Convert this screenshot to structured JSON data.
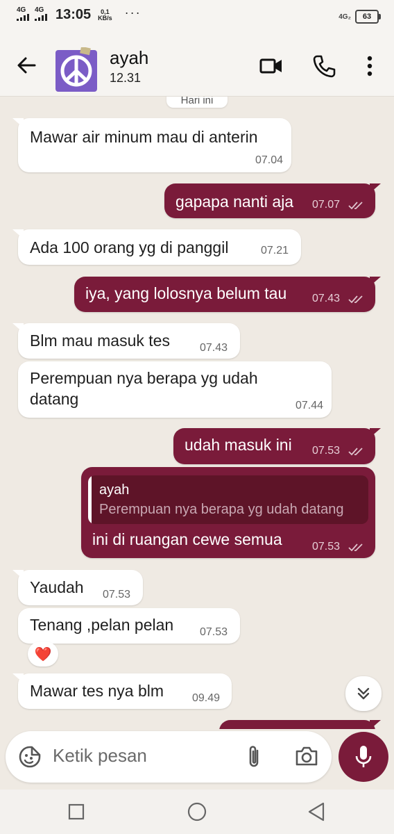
{
  "status_bar": {
    "network1": "4G",
    "network2": "4G",
    "time": "13:05",
    "speed_value": "0,1",
    "speed_unit": "KB/s",
    "dots": "···",
    "network_right": "4G₂",
    "battery": "63"
  },
  "header": {
    "name": "ayah",
    "subtitle": "12.31",
    "avatar_icon": "peace-sign-icon"
  },
  "chat": {
    "date_chip": "Hari ini",
    "messages": [
      {
        "dir": "in",
        "text": "Mawar air minum mau di anterin",
        "time": "07.04"
      },
      {
        "dir": "out",
        "text": "gapapa nanti aja",
        "time": "07.07"
      },
      {
        "dir": "in",
        "text": "Ada 100 orang yg di panggil",
        "time": "07.21"
      },
      {
        "dir": "out",
        "text": "iya, yang lolosnya belum tau",
        "time": "07.43"
      },
      {
        "dir": "in",
        "text": "Blm mau masuk tes",
        "time": "07.43"
      },
      {
        "dir": "in",
        "text": "Perempuan nya berapa yg udah\ndatang",
        "time": "07.44"
      },
      {
        "dir": "out",
        "text": "udah masuk ini",
        "time": "07.53"
      },
      {
        "dir": "out",
        "quote_name": "ayah",
        "quote_text": "Perempuan nya berapa yg udah datang",
        "text": "ini di ruangan cewe semua",
        "time": "07.53"
      },
      {
        "dir": "in",
        "text": "Yaudah",
        "time": "07.53"
      },
      {
        "dir": "in",
        "text": "Tenang ,pelan pelan",
        "time": "07.53",
        "reaction": "❤️"
      },
      {
        "dir": "in",
        "text": "Mawar tes nya blm",
        "time": "09.49"
      }
    ]
  },
  "input": {
    "placeholder": "Ketik pesan"
  },
  "colors": {
    "outgoing_bubble": "#7a1b3a",
    "incoming_bubble": "#ffffff",
    "background": "#efeae3"
  }
}
